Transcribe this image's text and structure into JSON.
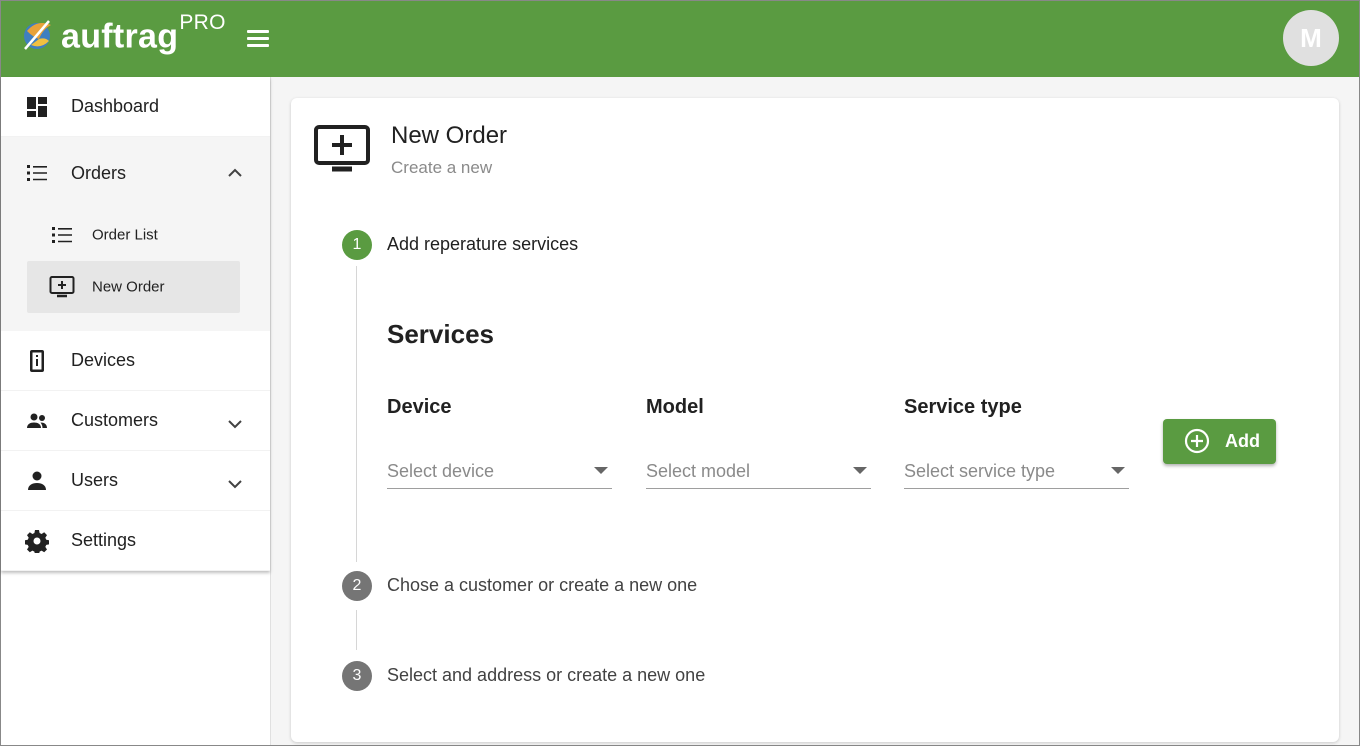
{
  "header": {
    "brand_main": "auftrag",
    "brand_sup": "PRO",
    "avatar_initial": "M",
    "accent_color": "#5a9b41"
  },
  "sidebar": {
    "items": [
      {
        "label": "Dashboard",
        "icon": "dashboard-icon"
      },
      {
        "label": "Orders",
        "icon": "list-icon",
        "expanded": true,
        "children": [
          {
            "label": "Order List",
            "icon": "list-icon"
          },
          {
            "label": "New Order",
            "icon": "add-to-queue-icon",
            "active": true
          }
        ]
      },
      {
        "label": "Devices",
        "icon": "device-info-icon"
      },
      {
        "label": "Customers",
        "icon": "people-icon",
        "expanded": false
      },
      {
        "label": "Users",
        "icon": "person-icon",
        "expanded": false
      },
      {
        "label": "Settings",
        "icon": "gear-icon"
      }
    ]
  },
  "page": {
    "title": "New Order",
    "subtitle": "Create a new"
  },
  "steps": [
    {
      "number": "1",
      "label": "Add reperature services",
      "state": "active"
    },
    {
      "number": "2",
      "label": "Chose a customer or create a new one",
      "state": "inactive"
    },
    {
      "number": "3",
      "label": "Select and address or create a new one",
      "state": "inactive"
    }
  ],
  "services": {
    "title": "Services",
    "fields": [
      {
        "label": "Device",
        "placeholder": "Select device"
      },
      {
        "label": "Model",
        "placeholder": "Select model"
      },
      {
        "label": "Service type",
        "placeholder": "Select service type"
      }
    ],
    "add_label": "Add"
  }
}
